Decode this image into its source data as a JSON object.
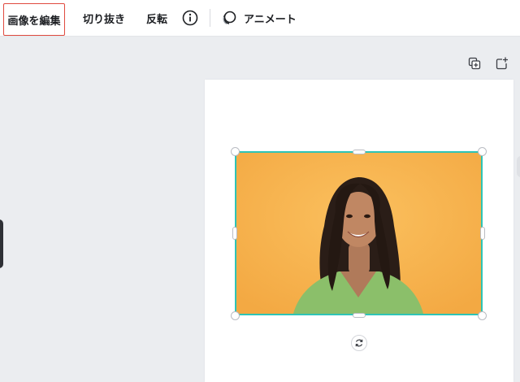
{
  "toolbar": {
    "edit_image": "画像を編集",
    "crop": "切り抜き",
    "flip": "反転",
    "info_icon": "info-icon",
    "animate": "アニメート",
    "animate_icon": "animate-icon"
  },
  "page_actions": {
    "duplicate_icon": "duplicate-page-icon",
    "add_icon": "add-page-icon"
  },
  "selection": {
    "accent": "#2ec4b6",
    "rotate_icon": "rotate-icon"
  },
  "image": {
    "background": "#f6b34e",
    "subject": "smiling woman with long dark hair in green top"
  },
  "colors": {
    "highlight_border": "#e04a3f",
    "canvas_bg": "#ffffff",
    "workspace_bg": "#ebedf0"
  }
}
